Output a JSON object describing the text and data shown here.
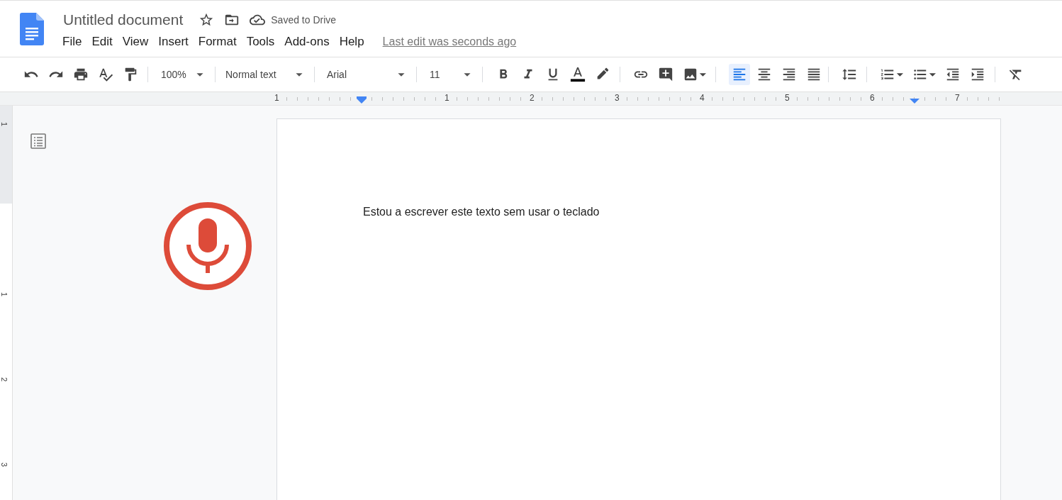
{
  "header": {
    "title": "Untitled document",
    "save_status": "Saved to Drive",
    "menu": [
      "File",
      "Edit",
      "View",
      "Insert",
      "Format",
      "Tools",
      "Add-ons",
      "Help"
    ],
    "last_edit": "Last edit was seconds ago"
  },
  "toolbar": {
    "zoom": "100%",
    "style": "Normal text",
    "font": "Arial",
    "size": "11",
    "alignments": [
      {
        "kind": "left",
        "selected": true
      },
      {
        "kind": "center",
        "selected": false
      },
      {
        "kind": "right",
        "selected": false
      },
      {
        "kind": "justify",
        "selected": false
      }
    ]
  },
  "ruler": {
    "horizontal": [
      "1",
      "1",
      "2",
      "3",
      "4",
      "5",
      "6",
      "7"
    ],
    "vertical": [
      "1",
      "1",
      "2",
      "3"
    ]
  },
  "document": {
    "text": "Estou a escrever este texto sem usar o teclado"
  }
}
